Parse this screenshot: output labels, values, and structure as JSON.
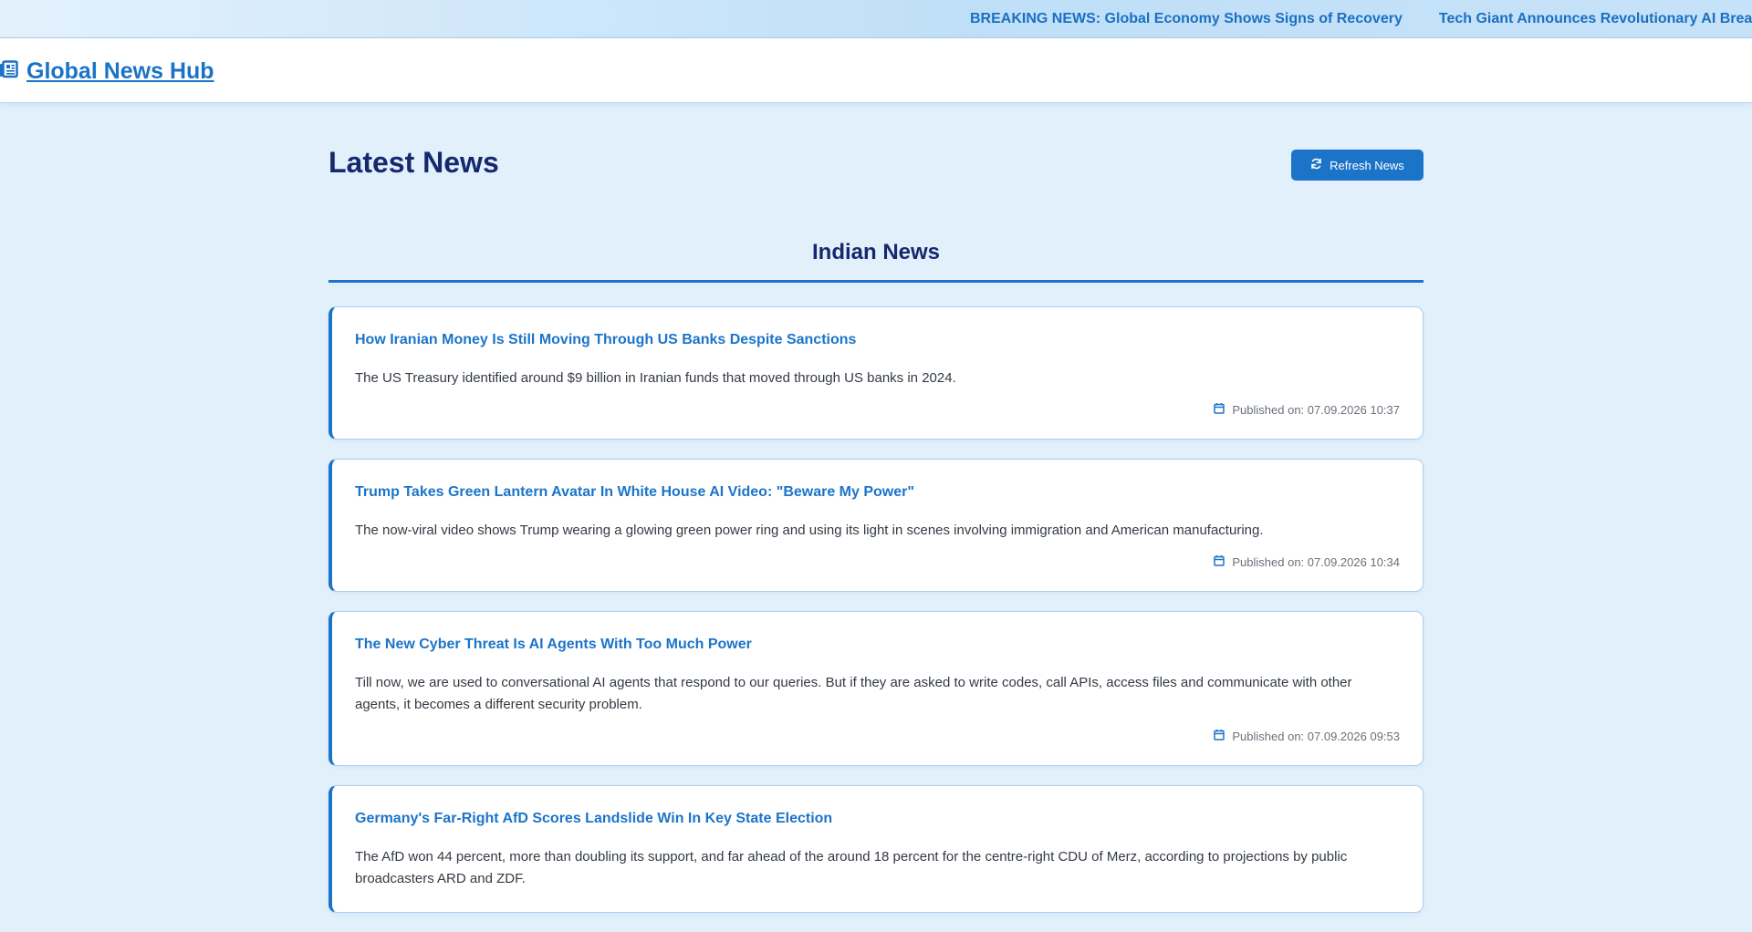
{
  "ticker": {
    "items": [
      "BREAKING NEWS: Global Economy Shows Signs of Recovery",
      "Tech Giant Announces Revolutionary AI Brea"
    ]
  },
  "header": {
    "brand_icon": "newspaper-icon",
    "brand": "Global News Hub"
  },
  "main": {
    "title": "Latest News",
    "refresh_icon": "refresh-icon",
    "refresh_label": "Refresh News",
    "section_title": "Indian News",
    "articles": [
      {
        "title": "How Iranian Money Is Still Moving Through US Banks Despite Sanctions",
        "description": "The US Treasury identified around $9 billion in Iranian funds that moved through US banks in 2024.",
        "published": "Published on: 07.09.2026 10:37"
      },
      {
        "title": "Trump Takes Green Lantern Avatar In White House AI Video: \"Beware My Power\"",
        "description": "The now-viral video shows Trump wearing a glowing green power ring and using its light in scenes involving immigration and American manufacturing.",
        "published": "Published on: 07.09.2026 10:34"
      },
      {
        "title": "The New Cyber Threat Is AI Agents With Too Much Power",
        "description": "Till now, we are used to conversational AI agents that respond to our queries. But if they are asked to write codes, call APIs, access files and communicate with other agents, it becomes a different security problem.",
        "published": "Published on: 07.09.2026 09:53"
      },
      {
        "title": "Germany's Far-Right AfD Scores Landslide Win In Key State Election",
        "description": "The AfD won 44 percent, more than doubling its support, and far ahead of the around 18 percent for the centre-right CDU of Merz, according to projections by public broadcasters ARD and ZDF.",
        "published": ""
      }
    ]
  },
  "colors": {
    "accent": "#1c74c8",
    "heading": "#16286e",
    "background": "#e2f0fb"
  }
}
